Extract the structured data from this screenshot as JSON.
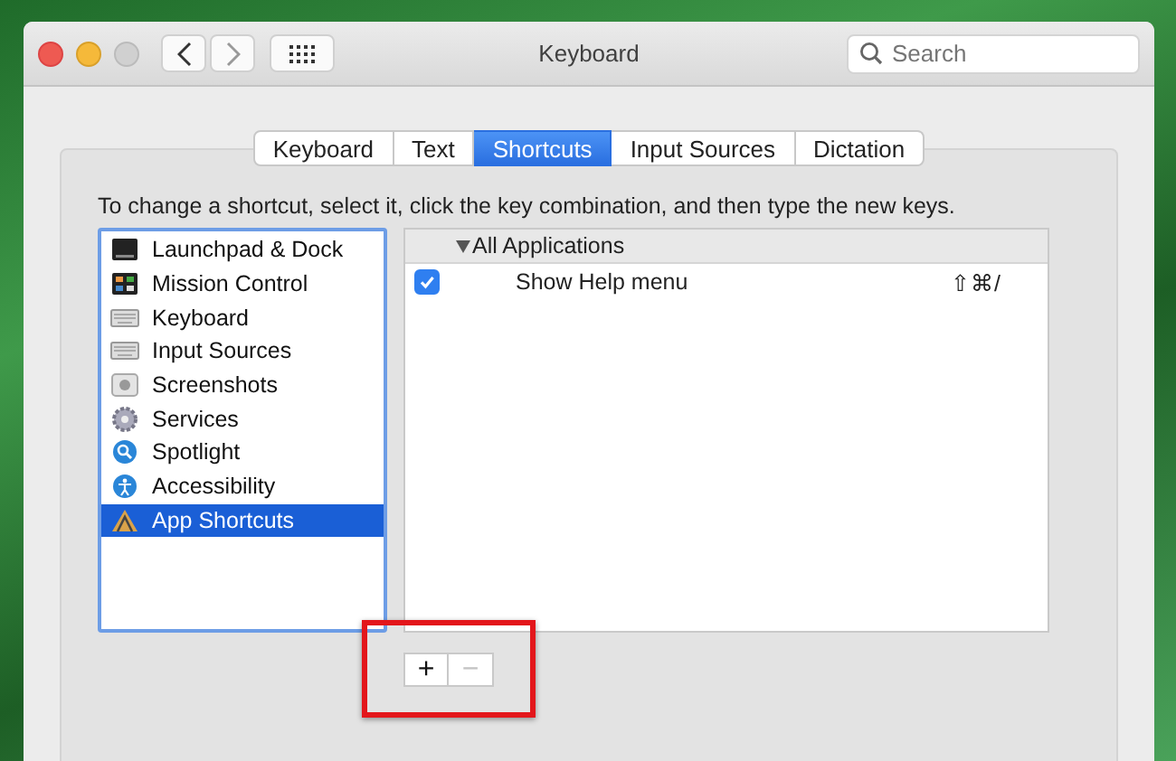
{
  "window": {
    "title": "Keyboard"
  },
  "search": {
    "placeholder": "Search"
  },
  "tabs": [
    {
      "label": "Keyboard",
      "selected": false
    },
    {
      "label": "Text",
      "selected": false
    },
    {
      "label": "Shortcuts",
      "selected": true
    },
    {
      "label": "Input Sources",
      "selected": false
    },
    {
      "label": "Dictation",
      "selected": false
    }
  ],
  "instruction": "To change a shortcut, select it, click the key combination, and then type the new keys.",
  "sidebar": {
    "items": [
      {
        "label": "Launchpad & Dock",
        "selected": false
      },
      {
        "label": "Mission Control",
        "selected": false
      },
      {
        "label": "Keyboard",
        "selected": false
      },
      {
        "label": "Input Sources",
        "selected": false
      },
      {
        "label": "Screenshots",
        "selected": false
      },
      {
        "label": "Services",
        "selected": false
      },
      {
        "label": "Spotlight",
        "selected": false
      },
      {
        "label": "Accessibility",
        "selected": false
      },
      {
        "label": "App Shortcuts",
        "selected": true
      }
    ]
  },
  "shortcuts": {
    "group": {
      "label": "All Applications",
      "expanded": true
    },
    "rows": [
      {
        "label": "Show Help menu",
        "checked": true,
        "keys": "⇧⌘/"
      }
    ]
  },
  "buttons": [
    {
      "label": "+",
      "disabled": false
    },
    {
      "label": "−",
      "disabled": true
    }
  ]
}
